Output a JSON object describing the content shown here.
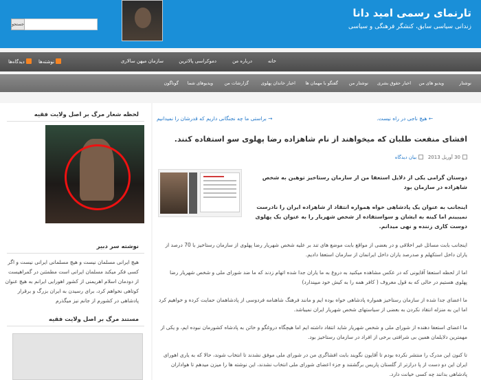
{
  "header": {
    "title": "تارنمای رسمی امید دانا",
    "description": "زندانی سیاسی سابق، کنشگر فرهنگی و سیاسی",
    "search_button": "جستجو"
  },
  "nav_primary": {
    "items": [
      "خانه",
      "درباره من",
      "دموکراسی پالاترین",
      "سازمان میهن سالاری"
    ],
    "feeds": [
      "نوشته‌ها",
      "دیدگاه‌ها"
    ]
  },
  "nav_secondary": {
    "items": [
      "نوشتار",
      "ویدیو های من",
      "اخبار حقوق بشری",
      "نوشتار من",
      "گفتگو با مهمان ها",
      "اخبار خاندان پهلوی",
      "گزارشات من",
      "ویدیوهای شما",
      "گوناگون"
    ]
  },
  "post": {
    "prev_link": "← هیچ ناجی در راه نیست.",
    "next_link": "براستی ما چه نجنگانی داریم که قدرشان را نمیدانیم →",
    "title": "افشای منفعت طلبان که میخواهند از نام شاهزاده رضا پهلوی سو استفاده کنند.",
    "date": "30 آوریل 2013",
    "comments_link": "بیان دیدگاه",
    "paragraphs": [
      "دوستان گرامی یکی از دلایل استعفا من از سازمان رستاخیز توهین به شخص شاهزاده در سازمان بود",
      "اینجانب به عنوان یک پادشاهی خواه همواره انتقاد از شاهزاده ایران را نادرست نمیبینم اما کینه به ایشان و سواستفاده از شخص شهریار را به عنوان یک پهلوی دوست کاری زننده و نهی میدانم.",
      "اینجانب بابت مسائل غیر اخلاقی و در بعضی از مواقع بابت موضع های تند بر علیه شخص شهریار رضا پهلوی از سازمان رستاخیز با 70 درصد از یاران داخل استکهلم و صدرصد یاران داخل ایرانمان از سازمان استعفا دادیم.",
      "اما از لحظه استعفا آقایونی که در عکس مشاهده میکنید به دروغ به ما یاران جدا شده اتهام زدند که ما ضد شورای ملی و شخص شهریار رضا پهلوی هستیم در حالی که به قول معروف ( کافر همه را به کیش خود میپندارد)",
      "ما اعضای جدا شده از سازمان رستاخیز همواره پادشاهی خواه بوده ایم و مانند فرهنگ شاهنامه فردوسی از پادشاهمان حمایت کرده و خواهیم کرد اما این به منزله انتقاد نکردن به بعضی از سیاستهای شخص شهریار ایران نمیباشد.",
      "ما اعضای استعفا دهنده از شورای ملی و شخص شهریار شاید انتقاد داشته ایم اما هیچگاه دروغگو و خائن به پادشاه کشورمان نبوده ایم، و یکی از مهمترین دلایلمان همین بی شرافتی برخی از افراد در سازمان رستاخیز بود.",
      "تا کنون این مدرک را منتشر نکرده بودم تا آقایون نگویند بابت افشاگری من در شورای ملی موفق نشدند تا انتخاب شوند، حالا که به یاری اهورای ایران این دو دست از پا درازتر از گلستان پاریس برگشتند و جزء اعضای شورای ملی انتخاب نشدند، این نوشته ها را میزن میدهم تا هواداران پادشاهی بدانند چه کسی خیانت دارد."
    ]
  },
  "sidebar": {
    "widget1_title": "لحظه شعار مرگ بر اصل ولایت فقیه",
    "widget2_title": "نوشته سر دبیر",
    "widget2_text": "هیچ ایرانی مسلمان نیست و هیچ مسلمانی ایرانی نیست و اگر کسی فکر میکند مسلمان ایرانی است مطمئنن در گمراهیست از دودمان اسلام اهریمنی از کشور اهورایی ایرانم به هیچ عنوان کوتاهی نخواهم کرد، برای رسیدن به ایران بزرگ و برقرار پادشاهی در کشورم از جانم نیز میگذرم",
    "widget3_title": "مستند مرگ بر اصل ولایت فقیه"
  }
}
